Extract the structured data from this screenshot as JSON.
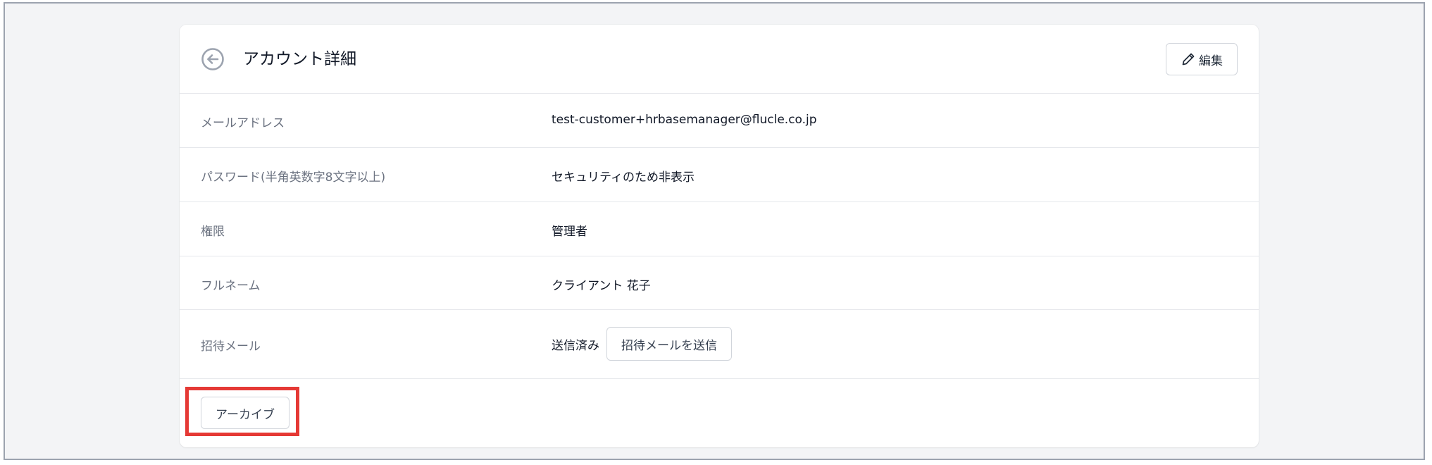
{
  "header": {
    "title": "アカウント詳細",
    "edit_label": "編集",
    "back_icon": "arrow-left-circle-icon",
    "edit_icon": "pencil-icon"
  },
  "fields": [
    {
      "label": "メールアドレス",
      "value": "test-customer+hrbasemanager@flucle.co.jp"
    },
    {
      "label": "パスワード(半角英数字8文字以上)",
      "value": "セキュリティのため非表示"
    },
    {
      "label": "権限",
      "value": "管理者"
    },
    {
      "label": "フルネーム",
      "value": "クライアント 花子"
    }
  ],
  "invite": {
    "label": "招待メール",
    "status": "送信済み",
    "button_label": "招待メールを送信"
  },
  "footer": {
    "archive_label": "アーカイブ"
  },
  "colors": {
    "highlight": "#e53935",
    "background": "#f3f4f6",
    "card": "#ffffff",
    "label": "#6b7280",
    "text": "#111827",
    "border": "#e5e7eb"
  }
}
